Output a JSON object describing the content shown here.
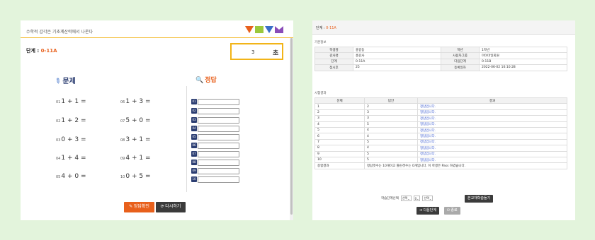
{
  "colors": {
    "background": "#e3f4dc",
    "accent": "#e8601c",
    "timer_border": "#f2b418",
    "navy": "#2c3e72",
    "link_blue": "#3a5bd0"
  },
  "left_panel": {
    "subtitle": "수학적 감각은 기초계산력에서 나온다",
    "level_label": "단계 : ",
    "level_value": "0-11A",
    "timer": {
      "value": "3",
      "unit": "초"
    },
    "question_heading": "문제",
    "answer_heading": "정답",
    "problems": [
      {
        "num": "01",
        "text": "1 + 1 ="
      },
      {
        "num": "02",
        "text": "1 + 2 ="
      },
      {
        "num": "03",
        "text": "0 + 3 ="
      },
      {
        "num": "04",
        "text": "1 + 4 ="
      },
      {
        "num": "05",
        "text": "4 + 0 ="
      },
      {
        "num": "06",
        "text": "1 + 3 ="
      },
      {
        "num": "07",
        "text": "5 + 0 ="
      },
      {
        "num": "08",
        "text": "3 + 1 ="
      },
      {
        "num": "09",
        "text": "4 + 1 ="
      },
      {
        "num": "10",
        "text": "0 + 5 ="
      }
    ],
    "answer_numbers": [
      "01",
      "02",
      "03",
      "04",
      "05",
      "06",
      "07",
      "08",
      "09",
      "10"
    ],
    "buttons": {
      "check": "✎ 정답확인",
      "retry": "⟳ 다시하기"
    }
  },
  "right_panel": {
    "title_label": "단계 : ",
    "title_value": "0-11A",
    "basic_section": "기본정보",
    "basic_rows": [
      [
        "학생명",
        "홍길동",
        "학년",
        "1학년"
      ],
      [
        "감사명",
        "홍감사",
        "사용자그룹",
        "마이마일회원"
      ],
      [
        "단계",
        "0-11A",
        "다음단계",
        "0-11B"
      ],
      [
        "점시후",
        "25",
        "등록일자",
        "2022-06-02 10:10:28"
      ]
    ],
    "result_section": "시험결과",
    "result_headers": [
      "문제",
      "답안",
      "결과"
    ],
    "results": [
      [
        "1",
        "2",
        "정답입니다."
      ],
      [
        "2",
        "3",
        "정답입니다."
      ],
      [
        "3",
        "3",
        "정답입니다."
      ],
      [
        "4",
        "5",
        "정답입니다."
      ],
      [
        "5",
        "4",
        "정답입니다."
      ],
      [
        "6",
        "4",
        "정답입니다."
      ],
      [
        "7",
        "5",
        "정답입니다."
      ],
      [
        "8",
        "4",
        "정답입니다."
      ],
      [
        "9",
        "5",
        "정답입니다."
      ],
      [
        "10",
        "5",
        "정답입니다."
      ]
    ],
    "summary_label": "종합결과",
    "summary_text": "정답갯수는 10개이고 틀린갯수는 0개입니다. 이 학생은 Pass 하였습니다.",
    "controls": {
      "label": "학습단계선택",
      "select1": "선택",
      "select2": "0",
      "select3": "선택",
      "review_button": "본교재학습돌기",
      "next_button": "➔ 다음단계",
      "end_button": "⏻ 종료"
    }
  }
}
